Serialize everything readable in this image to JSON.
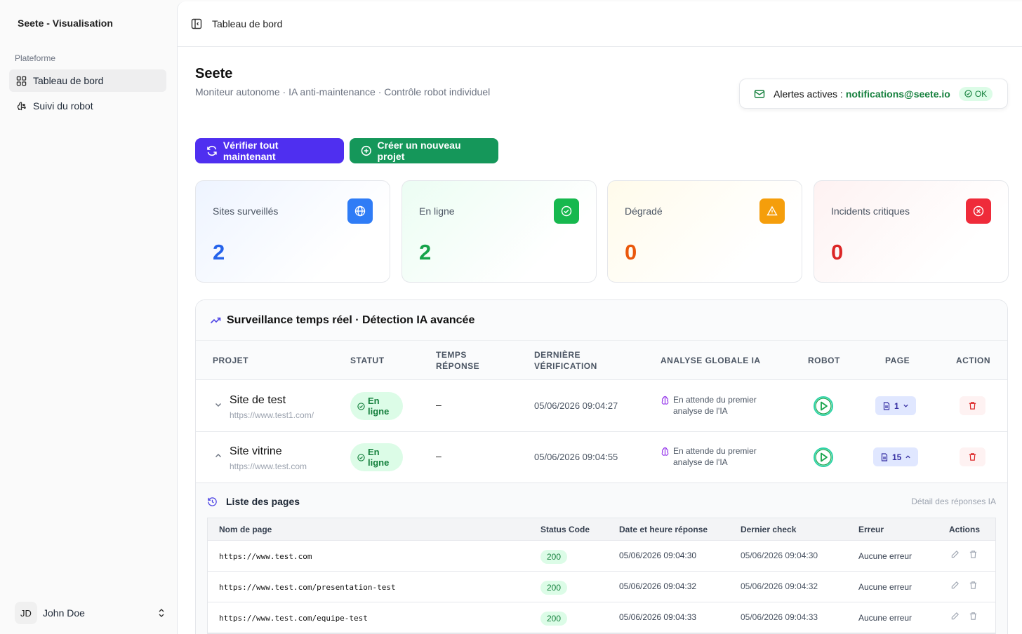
{
  "app": {
    "title": "Seete - Visualisation"
  },
  "sidebar": {
    "section": "Plateforme",
    "items": [
      {
        "label": "Tableau de bord",
        "icon": "dashboard-grid-icon",
        "active": true
      },
      {
        "label": "Suivi du robot",
        "icon": "robot-brain-icon",
        "active": false
      }
    ],
    "user": {
      "initials": "JD",
      "name": "John Doe"
    }
  },
  "topbar": {
    "breadcrumb": "Tableau de bord"
  },
  "header": {
    "title": "Seete",
    "subtitle": "Moniteur autonome · IA anti-maintenance · Contrôle robot individuel",
    "alert_label": "Alertes actives :",
    "alert_email": "notifications@seete.io",
    "alert_status": "OK"
  },
  "actions": {
    "verify_label": "Vérifier tout maintenant",
    "create_label": "Créer un nouveau projet"
  },
  "stats": [
    {
      "label": "Sites surveillés",
      "value": "2",
      "color": "#2563eb",
      "icon": "globe-icon"
    },
    {
      "label": "En ligne",
      "value": "2",
      "color": "#16a34a",
      "icon": "check-circle-icon"
    },
    {
      "label": "Dégradé",
      "value": "0",
      "color": "#ea580c",
      "icon": "warning-triangle-icon"
    },
    {
      "label": "Incidents critiques",
      "value": "0",
      "color": "#dc2626",
      "icon": "x-circle-icon"
    }
  ],
  "monitor": {
    "title": "Surveillance temps réel · Détection IA avancée",
    "columns": {
      "project": "PROJET",
      "status": "STATUT",
      "response_time": [
        "TEMPS",
        "RÉPONSE"
      ],
      "last_check": [
        "DERNIÈRE",
        "VÉRIFICATION"
      ],
      "ai_analysis": "ANALYSE GLOBALE IA",
      "robot": "ROBOT",
      "page": "PAGE",
      "action": "ACTION"
    },
    "projects": [
      {
        "name": "Site de test",
        "url": "https://www.test1.com/",
        "status": [
          "En",
          "ligne"
        ],
        "response_time": "–",
        "last_check": "05/06/2026 09:04:27",
        "analysis": [
          "En attende du premier",
          "analyse de l'IA"
        ],
        "pages": "1",
        "expanded": false
      },
      {
        "name": "Site vitrine",
        "url": "https://www.test.com",
        "status": [
          "En",
          "ligne"
        ],
        "response_time": "–",
        "last_check": "05/06/2026 09:04:55",
        "analysis": [
          "En attende du premier",
          "analyse de l'IA"
        ],
        "pages": "15",
        "expanded": true
      }
    ]
  },
  "pages_list": {
    "title": "Liste des pages",
    "right_link": "Détail des réponses IA",
    "columns": [
      "Nom de page",
      "Status Code",
      "Date et heure réponse",
      "Dernier check",
      "Erreur",
      "Actions"
    ],
    "rows": [
      {
        "url": "https://www.test.com",
        "code": "200",
        "response_at": "05/06/2026 09:04:30",
        "last_check": "05/06/2026 09:04:30",
        "error": "Aucune erreur"
      },
      {
        "url": "https://www.test.com/presentation-test",
        "code": "200",
        "response_at": "05/06/2026 09:04:32",
        "last_check": "05/06/2026 09:04:32",
        "error": "Aucune erreur"
      },
      {
        "url": "https://www.test.com/equipe-test",
        "code": "200",
        "response_at": "05/06/2026 09:04:33",
        "last_check": "05/06/2026 09:04:33",
        "error": "Aucune erreur"
      }
    ]
  }
}
